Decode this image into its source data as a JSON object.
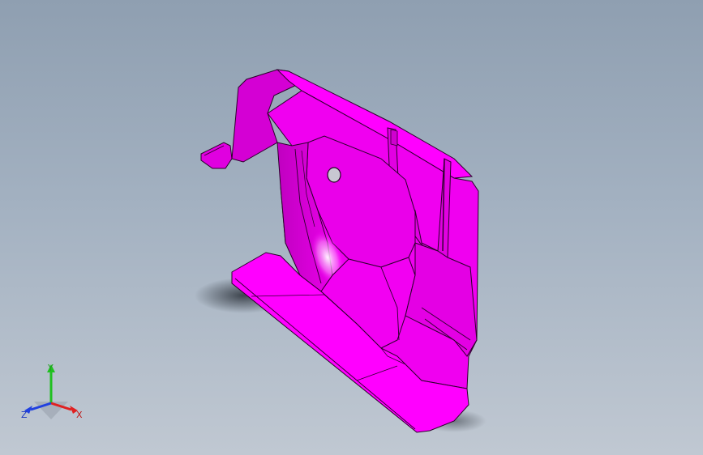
{
  "viewport": {
    "background_top": "#8f9fb1",
    "background_bottom": "#c0c8d2"
  },
  "model": {
    "name": "sheet-metal-bracket",
    "color": "#ff00ff",
    "edge_color": "#2a002a"
  },
  "triad": {
    "x_label": "X",
    "y_label": "Y",
    "z_label": "Z",
    "x_color": "#e02020",
    "y_color": "#20c020",
    "z_color": "#2040e0"
  }
}
